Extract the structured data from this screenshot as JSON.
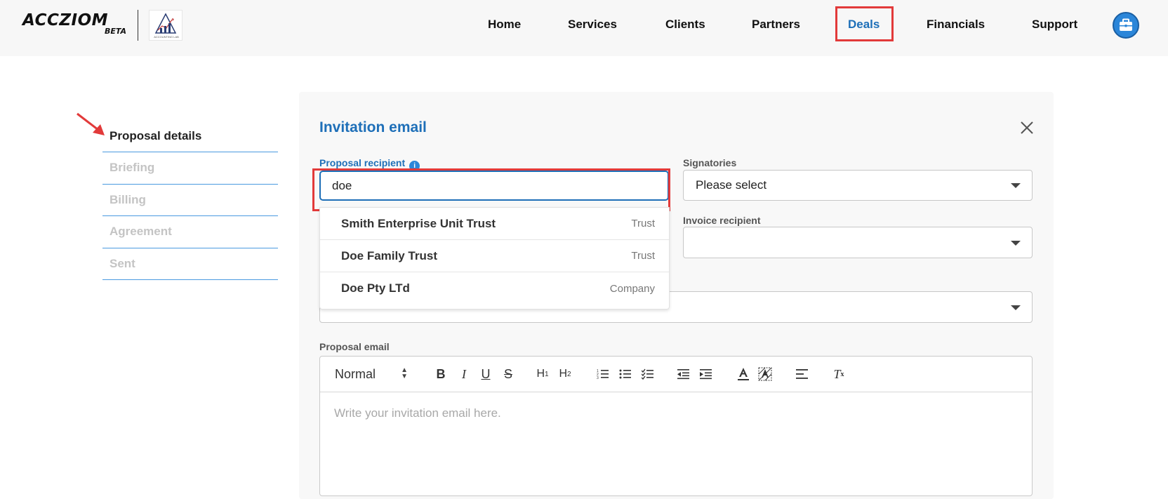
{
  "header": {
    "logo_text": "ACCZIOM",
    "logo_badge": "BETA",
    "partner_logo_caption": "ACCOUNTING LAB",
    "nav": [
      {
        "label": "Home"
      },
      {
        "label": "Services"
      },
      {
        "label": "Clients"
      },
      {
        "label": "Partners"
      },
      {
        "label": "Deals",
        "active": true
      },
      {
        "label": "Financials"
      },
      {
        "label": "Support"
      }
    ],
    "user_icon": "briefcase-icon"
  },
  "steps": [
    {
      "label": "Proposal details",
      "active": true
    },
    {
      "label": "Briefing"
    },
    {
      "label": "Billing"
    },
    {
      "label": "Agreement"
    },
    {
      "label": "Sent"
    }
  ],
  "panel": {
    "title": "Invitation email",
    "proposal_recipient": {
      "label": "Proposal recipient",
      "value": "doe"
    },
    "signatories": {
      "label": "Signatories",
      "value": "Please select"
    },
    "invoice_recipient": {
      "label": "Invoice recipient",
      "value": ""
    },
    "third_select_value": "",
    "suggestions": [
      {
        "name": "Smith Enterprise Unit Trust",
        "type": "Trust"
      },
      {
        "name": "Doe Family Trust",
        "type": "Trust"
      },
      {
        "name": "Doe Pty LTd",
        "type": "Company"
      }
    ],
    "proposal_email": {
      "label": "Proposal email",
      "style_select": "Normal",
      "placeholder": "Write your invitation email here."
    }
  },
  "colors": {
    "accent": "#1e6fb8",
    "highlight": "#e23a3a",
    "step_divider": "#4a9ae0"
  }
}
